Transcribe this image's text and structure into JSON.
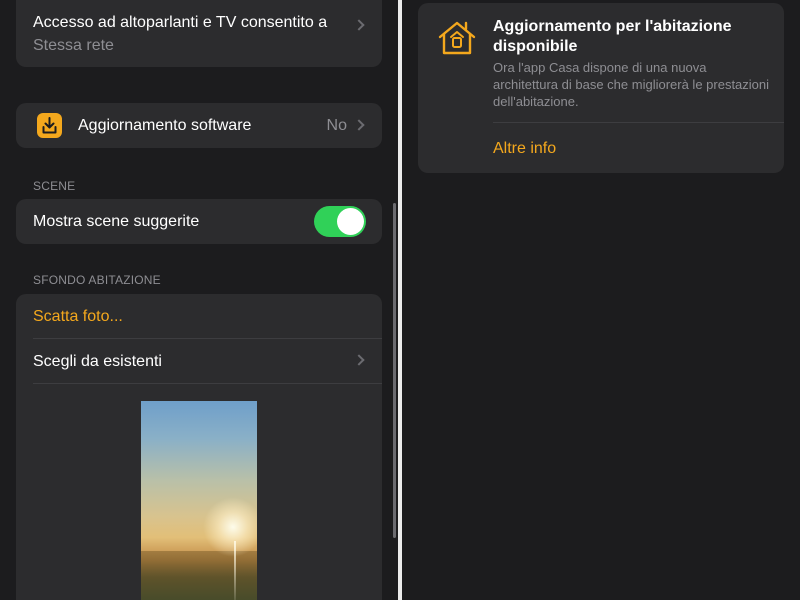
{
  "left": {
    "access": {
      "title": "Accesso ad altoparlanti e TV consentito a",
      "value": "Stessa rete"
    },
    "software_update": {
      "label": "Aggiornamento software",
      "value": "No"
    },
    "scenes": {
      "section_label": "SCENE",
      "suggested_label": "Mostra scene suggerite",
      "suggested_on": true
    },
    "background": {
      "section_label": "SFONDO ABITAZIONE",
      "take_photo": "Scatta foto...",
      "choose_existing": "Scegli da esistenti"
    }
  },
  "right": {
    "update_card": {
      "title": "Aggiornamento per l'abitazione disponibile",
      "description": "Ora l'app Casa dispone di una nuova architettura di base che migliorerà le prestazioni dell'abitazione.",
      "link": "Altre info"
    }
  },
  "colors": {
    "accent": "#f4a81d",
    "toggle_on": "#30d158",
    "background": "#1c1c1e",
    "card": "#2c2c2e",
    "secondary_text": "#8e8e93"
  },
  "icons": {
    "software_update": "download-icon",
    "home": "home-icon",
    "chevron": "chevron-right-icon"
  }
}
